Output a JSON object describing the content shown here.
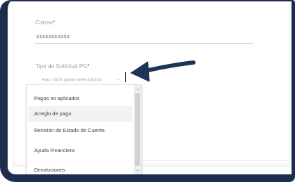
{
  "form": {
    "email_label": "Correo",
    "email_required": "*",
    "email_value": "xxxxxxxxxxx",
    "type_label": "Tipo de Solicitud PG",
    "type_required": "*",
    "type_placeholder": "Haz click para seleccionar"
  },
  "dropdown": {
    "options": [
      "Pagos no aplicados",
      "Arreglo de pago",
      "Revisión de Estado de Cuenta",
      "Ayuda Financiera",
      "Devoluciones"
    ],
    "hovered_index": 1
  },
  "colors": {
    "frame": "#1d2e4d",
    "arrow": "#1e3358"
  },
  "icons": {
    "chevron": "chevron-down-icon",
    "arrow": "pointer-arrow-icon"
  }
}
